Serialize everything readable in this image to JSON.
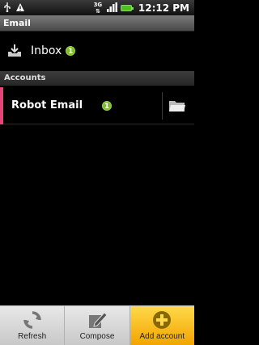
{
  "status_bar": {
    "time": "12:12 PM",
    "network_type": "3G",
    "icons": [
      "usb-icon",
      "warning-icon",
      "network-3g-icon",
      "signal-icon",
      "battery-icon"
    ],
    "battery_color": "#4cc31a"
  },
  "title_bar": {
    "title": "Email"
  },
  "inbox": {
    "label": "Inbox",
    "unread_count": "1",
    "icon": "download-tray-icon"
  },
  "accounts_section": {
    "header": "Accounts"
  },
  "accounts": [
    {
      "name": "Robot Email",
      "unread_count": "1",
      "accent_color": "#e6437a",
      "folder_icon": "folder-icon"
    }
  ],
  "bottom_panel": {
    "buttons": [
      {
        "label": "Refresh",
        "icon": "refresh-icon"
      },
      {
        "label": "Compose",
        "icon": "compose-icon"
      },
      {
        "label": "Add account",
        "icon": "add-icon",
        "highlight_color": "#f2a400"
      }
    ]
  }
}
